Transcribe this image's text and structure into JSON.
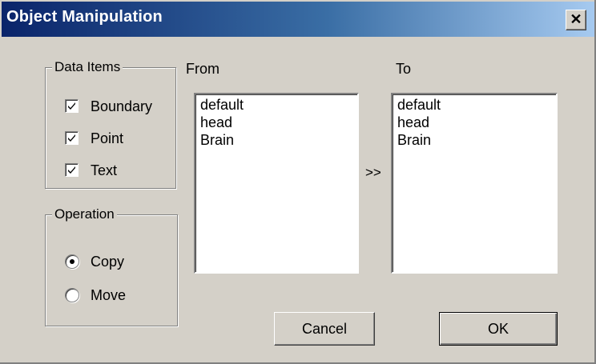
{
  "window": {
    "title": "Object Manipulation"
  },
  "data_items": {
    "legend": "Data Items",
    "items": [
      {
        "label": "Boundary",
        "checked": true
      },
      {
        "label": "Point",
        "checked": true
      },
      {
        "label": "Text",
        "checked": true
      }
    ]
  },
  "operation": {
    "legend": "Operation",
    "options": [
      {
        "label": "Copy",
        "selected": true
      },
      {
        "label": "Move",
        "selected": false
      }
    ]
  },
  "from": {
    "label": "From",
    "items": [
      "default",
      "head",
      "Brain"
    ]
  },
  "transfer": {
    "label": ">>"
  },
  "to": {
    "label": "To",
    "items": [
      "default",
      "head",
      "Brain"
    ]
  },
  "buttons": {
    "cancel": "Cancel",
    "ok": "OK"
  }
}
